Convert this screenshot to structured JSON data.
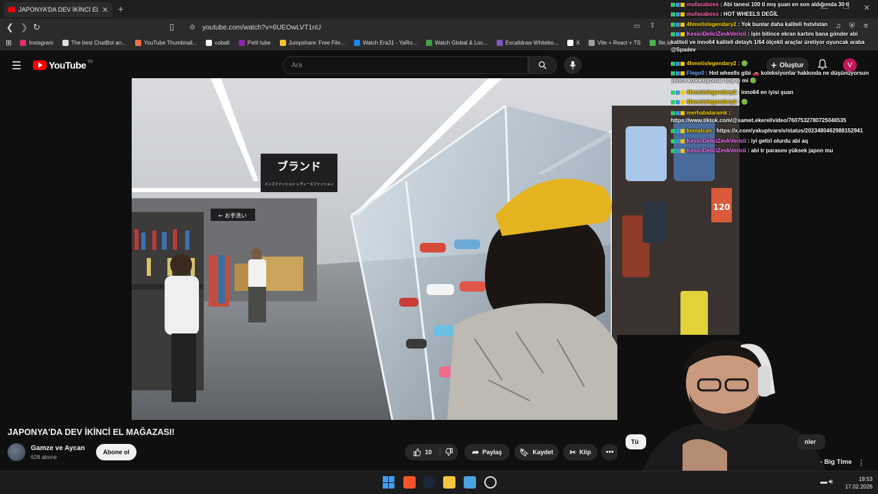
{
  "browser": {
    "tab_title": "JAPONYA'DA DEV İKİNCİ EL MAĞAZ",
    "url": "youtube.com/watch?v=6UEOwLVT1nU",
    "bookmarks": [
      {
        "label": "Instagram",
        "color": "#e1306c"
      },
      {
        "label": "The best ChatBot an...",
        "color": "#dddddd"
      },
      {
        "label": "YouTube Thumbnail...",
        "color": "#ff7043"
      },
      {
        "label": "cobalt",
        "color": "#ffffff"
      },
      {
        "label": "Petit tube",
        "color": "#8e24aa"
      },
      {
        "label": "Jumpshare: Free File...",
        "color": "#fbc02d"
      },
      {
        "label": "Watch Era31 - YaRo...",
        "color": "#1e88e5"
      },
      {
        "label": "Watch Global & Loc...",
        "color": "#43a047"
      },
      {
        "label": "Excalidraw Whitebo...",
        "color": "#7e57c2"
      },
      {
        "label": "X",
        "color": "#ffffff"
      },
      {
        "label": "Vite + React + TS",
        "color": "#9e9e9e"
      },
      {
        "label": "file.io",
        "color": "#4caf50"
      }
    ]
  },
  "youtube": {
    "logo_text": "YouTube",
    "logo_region": "TR",
    "search_placeholder": "Ara",
    "create_label": "Oluştur",
    "avatar_letter": "V"
  },
  "video": {
    "title": "JAPONYA'DA DEV İKİNCİ EL MAĞAZASI!",
    "store_sign_main": "ブランド",
    "store_sign_sub": "メンズファッション レディースファッション",
    "exit_sign": "← お手洗い",
    "price_tag": "120"
  },
  "channel": {
    "name": "Gamze ve Aycan",
    "subscribers": "628 abone",
    "subscribe_label": "Abone ol"
  },
  "actions": {
    "likes": "10",
    "share": "Paylaş",
    "save": "Kaydet",
    "clip": "Klip"
  },
  "sidebar": {
    "chip_all": "Tü",
    "chip_related": "nler",
    "related_title": "- Big Time"
  },
  "chat": [
    {
      "user": "mufasaboss",
      "color": "#ff69b4",
      "text": ": Abi tanesi 100 tl mış şuan en son aldığımda 30 tl"
    },
    {
      "user": "mufasaboss",
      "color": "#ff69b4",
      "text": ": HOT WHEELS DEĞİL"
    },
    {
      "user": "4hmetislegendary2",
      "color": "#ffd700",
      "text": ": Yok bunlar daha kaliteli hstvlstan"
    },
    {
      "user": "KesiciDeliciZevkVericii",
      "color": "#ff77ff",
      "text": ": işin bitince ekran kartını bana gönder abi"
    },
    {
      "user": "",
      "color": "#ffffff",
      "text": "kaliteli ve inno64 kaliteli detaylı 1/64 ölçekli araçlar üretiyor oyuncak araba @Spadev"
    },
    {
      "user": "4hmetislegendary2",
      "color": "#ffd700",
      "text": ": 🟢"
    },
    {
      "user": "Flego0",
      "color": "#6fa8ff",
      "text": ": Hot wheells gibi 🚗 koleksiyonlar hakkında ne düşünüyorsun sence koleksiyonlar boş iş mi 🟢"
    },
    {
      "user": "4hmetislegendary2",
      "color": "#ffd700",
      "text": ": inno64 en iyisi şuan"
    },
    {
      "user": "4hmetislegendary2",
      "color": "#ffd700",
      "text": ": 🟢"
    },
    {
      "user": "merhabalaramk",
      "color": "#ffd700",
      "text": ":"
    },
    {
      "user": "",
      "color": "#ffffff",
      "text": "https://www.tiktok.com/@samet.ekerel/video/7607532780725046535"
    },
    {
      "user": "kemalcan",
      "color": "#ffd700",
      "text": ": https://x.com/yakuptvarsiv/status/2023480462988152941"
    },
    {
      "user": "KesiciDeliciZevkVericii",
      "color": "#ff77ff",
      "text": ": iyi getiri olurdu abi aq"
    },
    {
      "user": "KesiciDeliciZevkVericii",
      "color": "#ff77ff",
      "text": ": abi tr parasını yüksek japon mu"
    }
  ],
  "taskbar": {
    "time": "19:53",
    "date": "17.02.2026"
  }
}
